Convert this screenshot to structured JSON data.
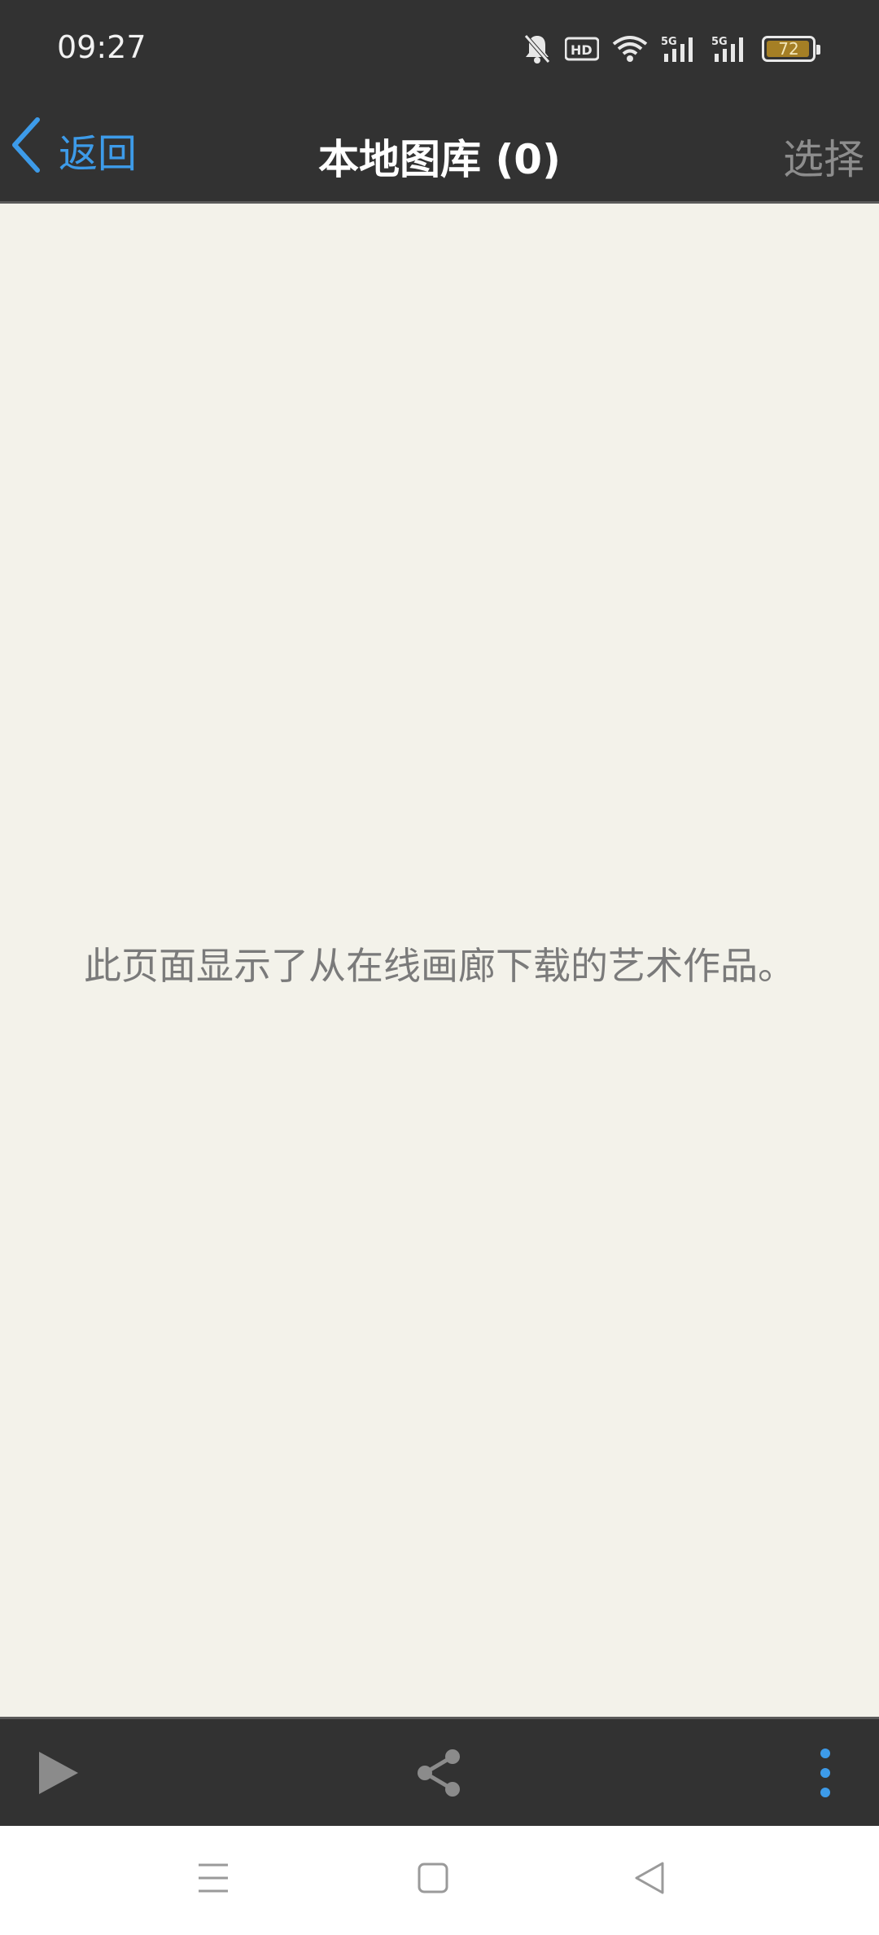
{
  "status_bar": {
    "time": "09:27",
    "battery_level": "72",
    "icons": [
      "bell-off-icon",
      "hd-icon",
      "wifi-icon",
      "5g-signal-icon",
      "5g-signal-icon",
      "battery-icon"
    ]
  },
  "nav": {
    "back_label": "返回",
    "title": "本地图库 (0)",
    "select_label": "选择"
  },
  "content": {
    "empty_message": "此页面显示了从在线画廊下载的艺术作品。"
  },
  "toolbar": {
    "icons": [
      "play-icon",
      "share-icon",
      "more-vertical-icon"
    ]
  },
  "system_nav": {
    "icons": [
      "menu-icon",
      "home-icon",
      "back-triangle-icon"
    ]
  },
  "colors": {
    "bar_background": "#323232",
    "content_background": "#f3f2ea",
    "accent": "#3d9be9",
    "muted_text": "#7a7a7a"
  }
}
